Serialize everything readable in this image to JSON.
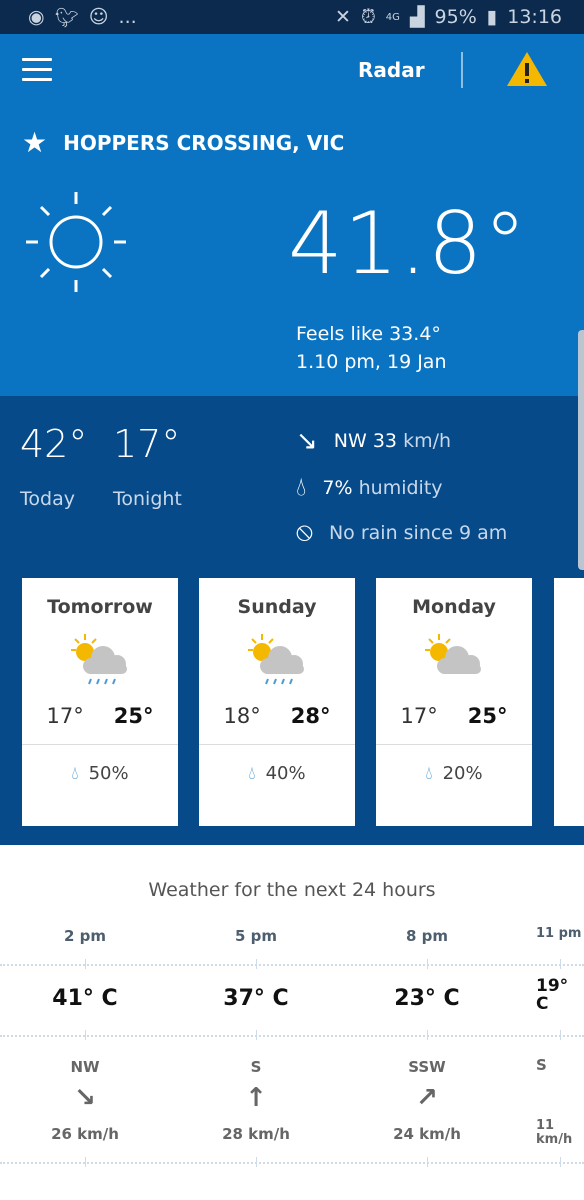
{
  "status_bar": {
    "time": "13:16",
    "battery": "95%",
    "network": "4G",
    "more": "..."
  },
  "header": {
    "radar_label": "Radar",
    "warning_color": "#f5b800"
  },
  "location": {
    "name": "HOPPERS CROSSING, VIC"
  },
  "current": {
    "temperature": "41.8°",
    "feels_like": "Feels like 33.4°",
    "observed": "1.10 pm, 19 Jan",
    "icon": "sun-icon"
  },
  "today": {
    "high": "42°",
    "high_label": "Today",
    "low": "17°",
    "low_label": "Tonight"
  },
  "conditions": {
    "wind_dir": "NW",
    "wind_speed": "33",
    "wind_unit": "km/h",
    "humidity_value": "7%",
    "humidity_label": "humidity",
    "rain": "No rain since 9 am"
  },
  "forecast": [
    {
      "day": "Tomorrow",
      "min": "17°",
      "max": "25°",
      "rain": "50%",
      "icon": "cloud-sun-rain-icon"
    },
    {
      "day": "Sunday",
      "min": "18°",
      "max": "28°",
      "rain": "40%",
      "icon": "cloud-sun-rain-icon"
    },
    {
      "day": "Monday",
      "min": "17°",
      "max": "25°",
      "rain": "20%",
      "icon": "cloud-sun-icon"
    }
  ],
  "next24": {
    "title": "Weather for the next 24 hours",
    "hours": [
      {
        "time": "2 pm",
        "temp": "41° C",
        "dir": "NW",
        "speed": "26 km/h"
      },
      {
        "time": "5 pm",
        "temp": "37° C",
        "dir": "S",
        "speed": "28 km/h"
      },
      {
        "time": "8 pm",
        "temp": "23° C",
        "dir": "SSW",
        "speed": "24 km/h"
      },
      {
        "time": "11 pm",
        "temp": "19° C",
        "dir": "S",
        "speed": "11 km/h"
      }
    ]
  }
}
